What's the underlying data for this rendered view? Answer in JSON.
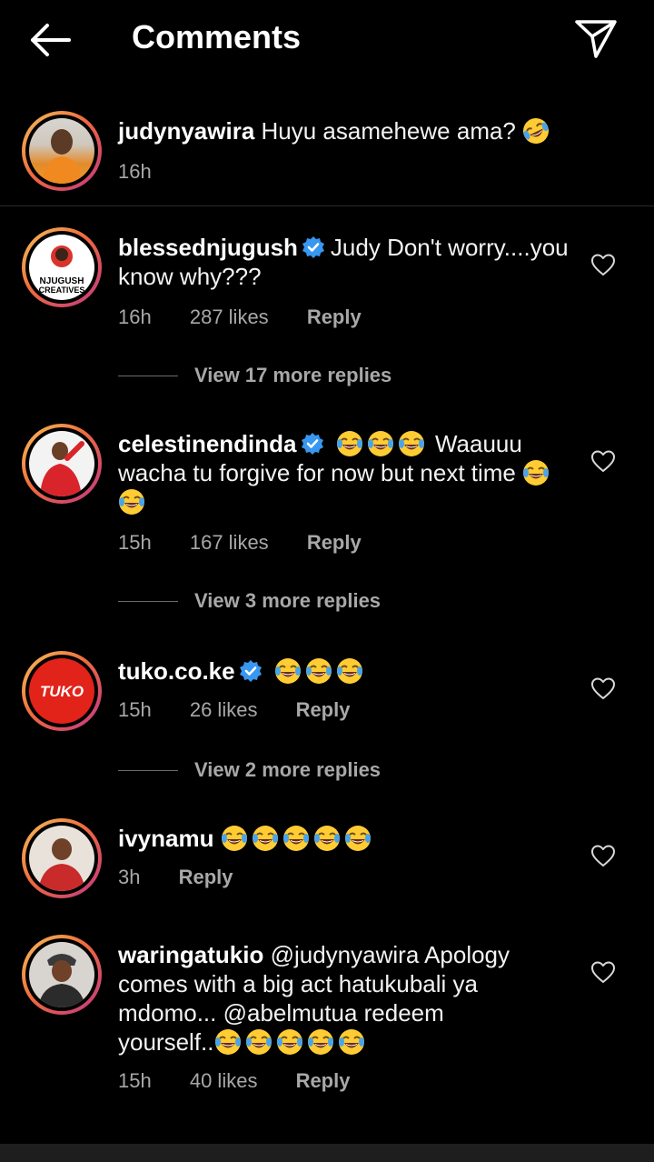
{
  "header": {
    "title": "Comments",
    "back_icon": "arrow-left-icon",
    "send_icon": "paper-plane-icon"
  },
  "caption": {
    "username": "judynyawira",
    "text": "Huyu asamehewe ama?",
    "emoji": "rolling-laughing-emoji",
    "time": "16h"
  },
  "comments": [
    {
      "username": "blessednjugush",
      "verified": true,
      "text": "Judy Don't worry....you know why???",
      "time": "16h",
      "likes": "287 likes",
      "reply": "Reply",
      "view_replies": "View 17 more replies",
      "avatar_text_1": "NJUGUSH",
      "avatar_text_2": "CREATIVES"
    },
    {
      "username": "celestinendinda",
      "verified": true,
      "text_after_emoji": "Waauuu wacha tu forgive for now but next time",
      "time": "15h",
      "likes": "167 likes",
      "reply": "Reply",
      "view_replies": "View 3 more replies"
    },
    {
      "username": "tuko.co.ke",
      "verified": true,
      "avatar_text": "TUKO",
      "time": "15h",
      "likes": "26 likes",
      "reply": "Reply",
      "view_replies": "View 2 more replies"
    },
    {
      "username": "ivynamu",
      "verified": false,
      "time": "3h",
      "reply": "Reply"
    },
    {
      "username": "waringatukio",
      "verified": false,
      "text": "@judynyawira Apology comes with a big act hatukubali ya mdomo... @abelmutua redeem yourself..",
      "time": "15h",
      "likes": "40 likes",
      "reply": "Reply"
    }
  ],
  "colors": {
    "background": "#000000",
    "text": "#f2f2f2",
    "muted": "#a8a8a8",
    "verified_blue": "#3897f0",
    "story_ring_start": "#f6c35b",
    "story_ring_end": "#c13584",
    "tuko_red": "#e2231a"
  }
}
